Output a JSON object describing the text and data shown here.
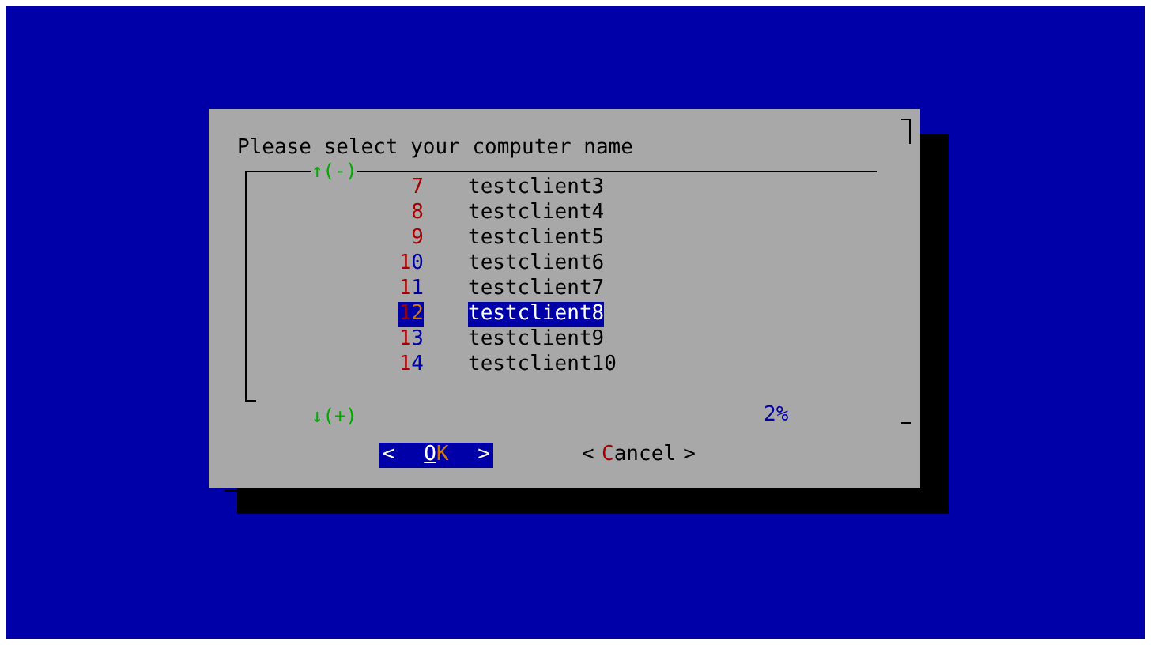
{
  "dialog": {
    "prompt": "Please select your computer name",
    "scroll_up": "↑(-)",
    "items": [
      {
        "tag": "7",
        "name": "testclient3",
        "selected": false
      },
      {
        "tag": "8",
        "name": "testclient4",
        "selected": false
      },
      {
        "tag": "9",
        "name": "testclient5",
        "selected": false
      },
      {
        "tag": "10",
        "name": "testclient6",
        "selected": false
      },
      {
        "tag": "11",
        "name": "testclient7",
        "selected": false
      },
      {
        "tag": "12",
        "name": "testclient8",
        "selected": true
      },
      {
        "tag": "13",
        "name": "testclient9",
        "selected": false
      },
      {
        "tag": "14",
        "name": "testclient10",
        "selected": false
      }
    ],
    "scroll_down": "↓(+)",
    "percent": "2%",
    "buttons": [
      {
        "left": "<",
        "label": "OK",
        "right": ">",
        "selected": true
      },
      {
        "left": "<",
        "label": "Cancel",
        "right": ">",
        "selected": false
      }
    ]
  }
}
